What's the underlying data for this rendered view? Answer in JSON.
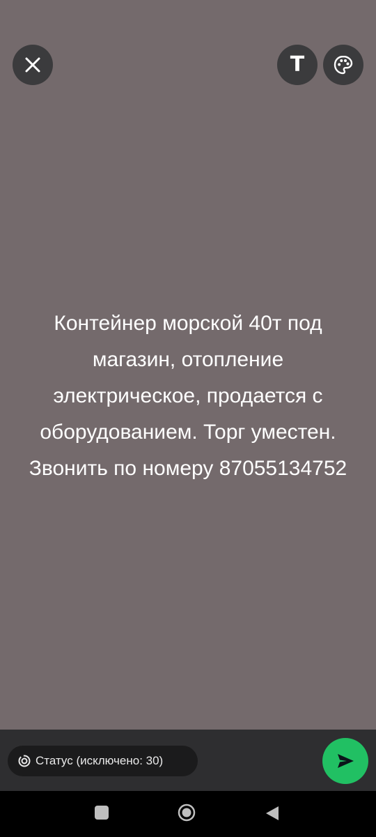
{
  "icons": {
    "close": "close-icon",
    "text": "text-icon",
    "palette": "palette-icon",
    "privacy": "status-privacy-icon",
    "send": "send-icon"
  },
  "toolbar": {
    "text_button_label": "T"
  },
  "status": {
    "text": "Контейнер морской 40т под магазин, отопление электрическое, продается с оборудованием. Торг уместен. Звонить по номеру 87055134752",
    "background_color": "#746a6c"
  },
  "footer": {
    "privacy_label": "Статус (исключено: 30)",
    "send_button_color": "#21c063"
  },
  "navigation": {
    "recent": "recent-apps-icon",
    "home": "home-icon",
    "back": "back-icon"
  }
}
